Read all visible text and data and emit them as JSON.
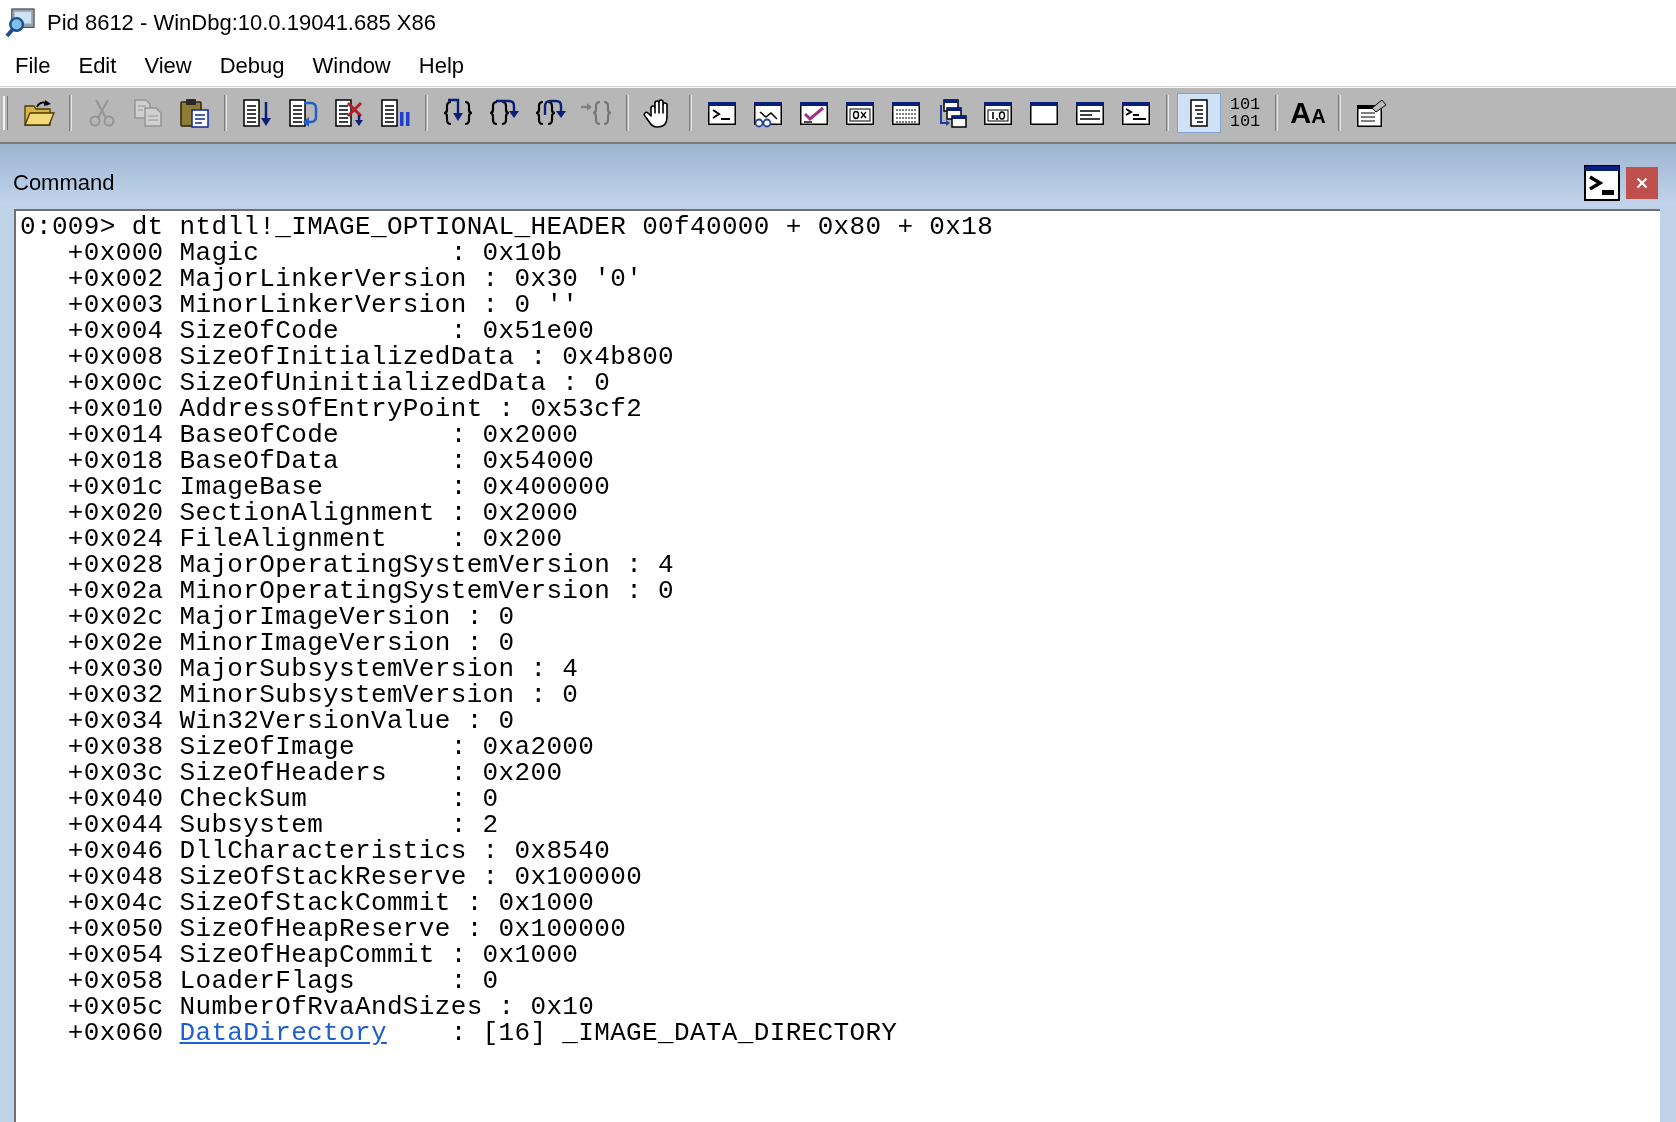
{
  "window": {
    "title": "Pid 8612 - WinDbg:10.0.19041.685 X86"
  },
  "menu": [
    "File",
    "Edit",
    "View",
    "Debug",
    "Window",
    "Help"
  ],
  "toolbar": {
    "groups": [
      [
        {
          "kind": "folder",
          "disabled": false,
          "on": false
        }
      ],
      [
        {
          "kind": "scissors",
          "disabled": true,
          "on": false
        },
        {
          "kind": "pages",
          "disabled": true,
          "on": false
        },
        {
          "kind": "clipboard",
          "disabled": false,
          "on": false
        }
      ],
      [
        {
          "kind": "docdown",
          "disabled": false,
          "on": false
        },
        {
          "kind": "docloop",
          "disabled": false,
          "on": false
        },
        {
          "kind": "doccross",
          "disabled": false,
          "on": false
        },
        {
          "kind": "docbars",
          "disabled": false,
          "on": false
        }
      ],
      [
        {
          "kind": "bracesdown",
          "disabled": false,
          "on": false
        },
        {
          "kind": "bracesover",
          "disabled": false,
          "on": false
        },
        {
          "kind": "bracesup",
          "disabled": false,
          "on": false
        },
        {
          "kind": "bracesin",
          "disabled": true,
          "on": false
        }
      ],
      [
        {
          "kind": "hand",
          "disabled": false,
          "on": false
        }
      ],
      [
        {
          "kind": "promptwin",
          "disabled": false,
          "on": false
        },
        {
          "kind": "glasseswin",
          "disabled": false,
          "on": false
        },
        {
          "kind": "checkwin",
          "disabled": false,
          "on": false
        },
        {
          "kind": "hexwin",
          "disabled": false,
          "on": false
        },
        {
          "kind": "listwin",
          "disabled": false,
          "on": false
        },
        {
          "kind": "stackwin",
          "disabled": false,
          "on": false
        },
        {
          "kind": "decimalwin",
          "disabled": false,
          "on": false
        },
        {
          "kind": "blankwin",
          "disabled": false,
          "on": false
        },
        {
          "kind": "textwin",
          "disabled": false,
          "on": false
        },
        {
          "kind": "terminalwin",
          "disabled": false,
          "on": false
        }
      ],
      [
        {
          "kind": "document",
          "disabled": false,
          "on": true
        },
        {
          "kind": "binary",
          "lines": [
            "101",
            "101"
          ],
          "disabled": false,
          "on": false
        }
      ],
      [
        {
          "kind": "fontsize",
          "letters": [
            "A",
            "A"
          ],
          "disabled": false,
          "on": false
        }
      ],
      [
        {
          "kind": "settingswin",
          "disabled": false,
          "on": false
        }
      ]
    ]
  },
  "command_window": {
    "title": "Command",
    "command": "0:009> dt ntdll!_IMAGE_OPTIONAL_HEADER 00f40000 + 0x80 + 0x18",
    "fields": [
      {
        "kind": "text",
        "text": "+0x000 Magic            : 0x10b"
      },
      {
        "kind": "text",
        "text": "+0x002 MajorLinkerVersion : 0x30 '0'"
      },
      {
        "kind": "text",
        "text": "+0x003 MinorLinkerVersion : 0 ''"
      },
      {
        "kind": "text",
        "text": "+0x004 SizeOfCode       : 0x51e00"
      },
      {
        "kind": "text",
        "text": "+0x008 SizeOfInitializedData : 0x4b800"
      },
      {
        "kind": "text",
        "text": "+0x00c SizeOfUninitializedData : 0"
      },
      {
        "kind": "text",
        "text": "+0x010 AddressOfEntryPoint : 0x53cf2"
      },
      {
        "kind": "text",
        "text": "+0x014 BaseOfCode       : 0x2000"
      },
      {
        "kind": "text",
        "text": "+0x018 BaseOfData       : 0x54000"
      },
      {
        "kind": "text",
        "text": "+0x01c ImageBase        : 0x400000"
      },
      {
        "kind": "text",
        "text": "+0x020 SectionAlignment : 0x2000"
      },
      {
        "kind": "text",
        "text": "+0x024 FileAlignment    : 0x200"
      },
      {
        "kind": "text",
        "text": "+0x028 MajorOperatingSystemVersion : 4"
      },
      {
        "kind": "text",
        "text": "+0x02a MinorOperatingSystemVersion : 0"
      },
      {
        "kind": "text",
        "text": "+0x02c MajorImageVersion : 0"
      },
      {
        "kind": "text",
        "text": "+0x02e MinorImageVersion : 0"
      },
      {
        "kind": "text",
        "text": "+0x030 MajorSubsystemVersion : 4"
      },
      {
        "kind": "text",
        "text": "+0x032 MinorSubsystemVersion : 0"
      },
      {
        "kind": "text",
        "text": "+0x034 Win32VersionValue : 0"
      },
      {
        "kind": "text",
        "text": "+0x038 SizeOfImage      : 0xa2000"
      },
      {
        "kind": "text",
        "text": "+0x03c SizeOfHeaders    : 0x200"
      },
      {
        "kind": "text",
        "text": "+0x040 CheckSum         : 0"
      },
      {
        "kind": "text",
        "text": "+0x044 Subsystem        : 2"
      },
      {
        "kind": "text",
        "text": "+0x046 DllCharacteristics : 0x8540"
      },
      {
        "kind": "text",
        "text": "+0x048 SizeOfStackReserve : 0x100000"
      },
      {
        "kind": "text",
        "text": "+0x04c SizeOfStackCommit : 0x1000"
      },
      {
        "kind": "text",
        "text": "+0x050 SizeOfHeapReserve : 0x100000"
      },
      {
        "kind": "text",
        "text": "+0x054 SizeOfHeapCommit : 0x1000"
      },
      {
        "kind": "text",
        "text": "+0x058 LoaderFlags      : 0"
      },
      {
        "kind": "text",
        "text": "+0x05c NumberOfRvaAndSizes : 0x10"
      },
      {
        "kind": "link",
        "offset": "+0x060",
        "link": "DataDirectory",
        "value": ": [16] _IMAGE_DATA_DIRECTORY"
      }
    ]
  }
}
